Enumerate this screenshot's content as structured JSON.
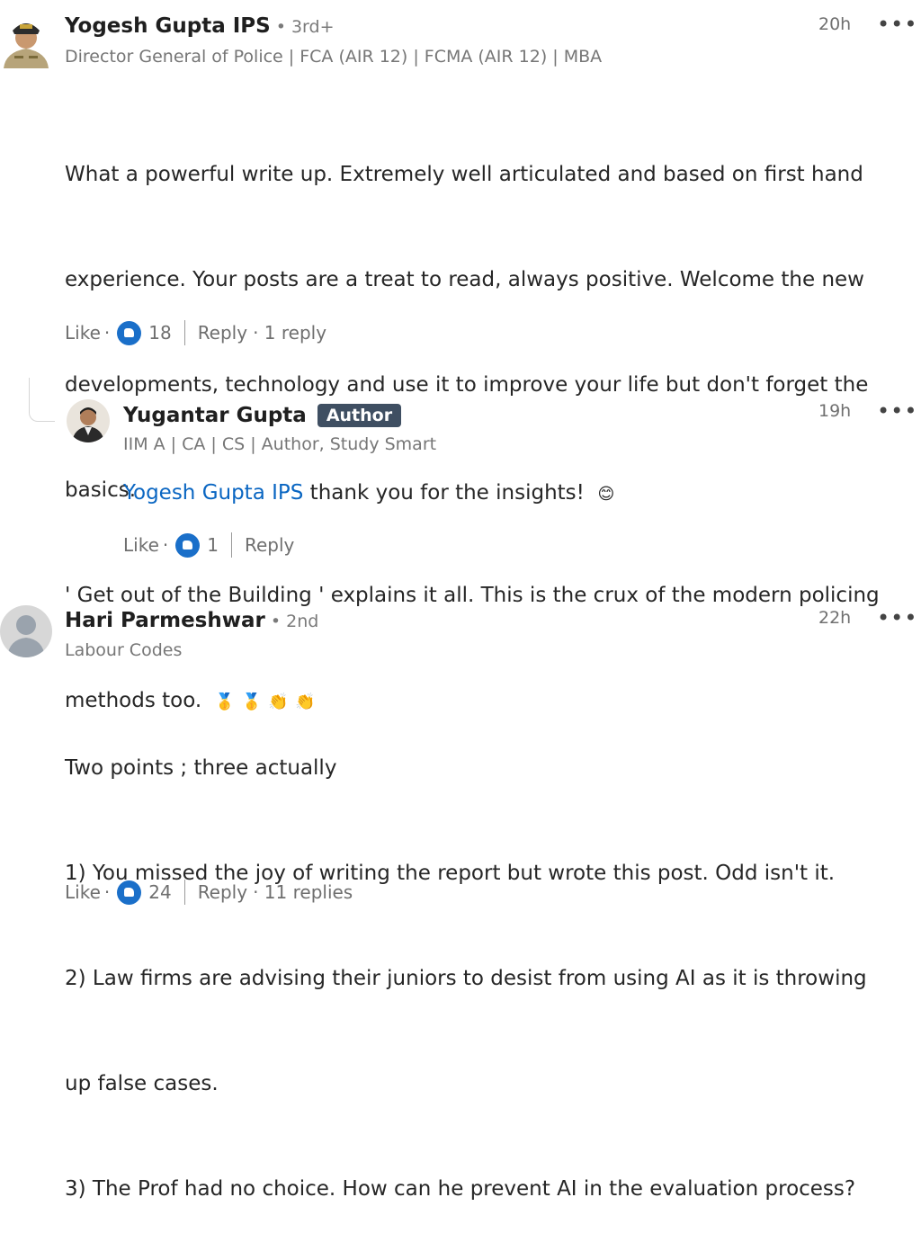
{
  "comments": [
    {
      "name": "Yogesh Gupta IPS",
      "degree": "• 3rd+",
      "headline": "Director General of Police | FCA (AIR 12) | FCMA (AIR 12) | MBA",
      "time": "20h",
      "more": "•••",
      "lines": [
        "What a powerful write up. Extremely well articulated and based on first hand",
        "experience. Your posts are a treat to read, always positive. Welcome the new",
        "developments, technology and use it to improve your life but don't forget the",
        "basics.",
        "' Get out of the Building ' explains it all. This is the crux of the modern policing",
        "methods too."
      ],
      "emojis": [
        "🥇",
        "🥇",
        "👏",
        "👏"
      ],
      "like": "Like",
      "dot": "·",
      "reactions": "18",
      "reply": "Reply",
      "replies": "· 1 reply"
    },
    {
      "name": "Hari Parmeshwar",
      "degree": "• 2nd",
      "headline": "Labour Codes",
      "time": "22h",
      "more": "•••",
      "lines": [
        "Two points ; three actually",
        "1) You missed the joy of writing the report but wrote this post. Odd isn't it.",
        "2) Law firms are advising their juniors to desist from using AI as it is throwing",
        "up false cases.",
        "3) The Prof had no choice. How can he prevent AI in the evaluation process?"
      ],
      "like": "Like",
      "dot": "·",
      "reactions": "24",
      "reply": "Reply",
      "replies": "· 11 replies"
    }
  ],
  "reply": {
    "name": "Yugantar Gupta",
    "badge": "Author",
    "headline": "IIM A | CA | CS | Author, Study Smart",
    "time": "19h",
    "more": "•••",
    "mention": "Yogesh Gupta IPS",
    "text": " thank you for the insights!",
    "emoji": "😊",
    "like": "Like",
    "dot": "·",
    "reactions": "1",
    "reply_label": "Reply"
  },
  "colors": {
    "link": "#0a66c2",
    "badge": "#3f4f62",
    "reaction": "#1a6fc9"
  }
}
